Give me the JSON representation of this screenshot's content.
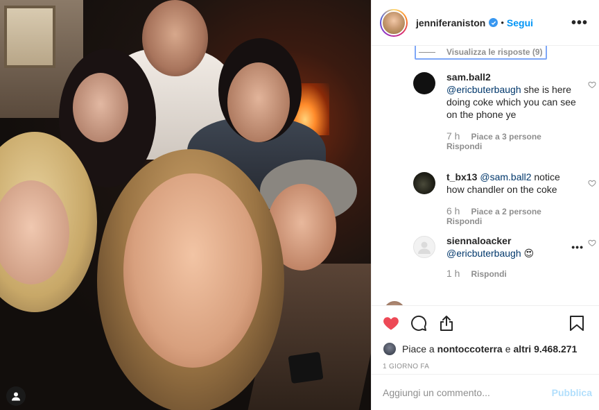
{
  "header": {
    "username": "jenniferaniston",
    "separator": "•",
    "follow_label": "Segui",
    "more_label": "•••"
  },
  "comments": {
    "view_replies_label": "Visualizza le risposte (9)",
    "items": [
      {
        "user": "sam.ball2",
        "mention": "@ericbuterbaugh",
        "text": " she is here doing coke which you can see on the phone ye",
        "time": "7 h",
        "likes": "Piace a 3 persone",
        "reply": "Rispondi"
      },
      {
        "user": "t_bx13",
        "mention": "@sam.ball2",
        "text": " notice how chandler on the coke",
        "time": "6 h",
        "likes": "Piace a 2 persone",
        "reply": "Rispondi"
      },
      {
        "user": "siennaloacker",
        "mention": "@ericbuterbaugh",
        "text": " 😍",
        "time": "1 h",
        "likes": "",
        "reply": "Rispondi"
      }
    ]
  },
  "likes": {
    "prefix": "Piace a",
    "user": "nontoccoterra",
    "and_others": "e",
    "others_count": "altri 9.468.271"
  },
  "date": "1 GIORNO FA",
  "add_comment": {
    "placeholder": "Aggiungi un commento...",
    "publish_label": "Pubblica"
  },
  "colors": {
    "link_blue": "#0095f6",
    "mention_blue": "#00376b",
    "like_red": "#ed4956",
    "muted": "#8e8e8e"
  },
  "icons": [
    "heart-icon",
    "comment-icon",
    "share-icon",
    "bookmark-icon",
    "verified-icon",
    "user-tag-icon"
  ]
}
